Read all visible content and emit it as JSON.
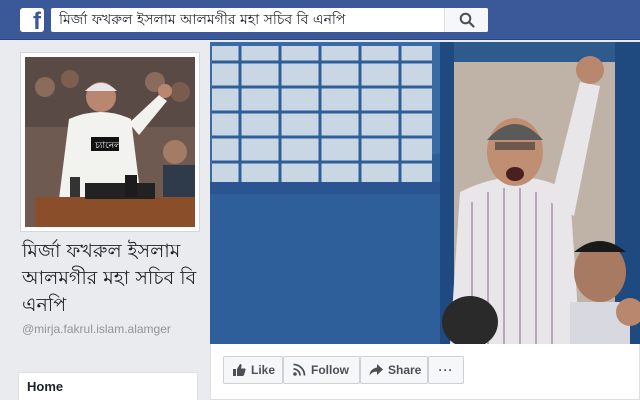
{
  "header": {
    "logo_letter": "f",
    "search": {
      "value": "মির্জা ফখরুল ইসলাম আলমগীর মহা সচিব বি এনপি",
      "icon": "search-icon"
    }
  },
  "profile": {
    "name": "মির্জা ফখরুল ইসলাম আলমগীর মহা সচিব বি এনপি",
    "handle": "@mirja.fakrul.islam.alamger"
  },
  "nav": {
    "home": "Home"
  },
  "actions": {
    "like": "Like",
    "follow": "Follow",
    "share": "Share",
    "more": "···"
  },
  "colors": {
    "topbar": "#3b5998",
    "button_bg": "#f6f7f9",
    "button_text": "#4b4f56",
    "page_bg": "#e9ebee"
  }
}
